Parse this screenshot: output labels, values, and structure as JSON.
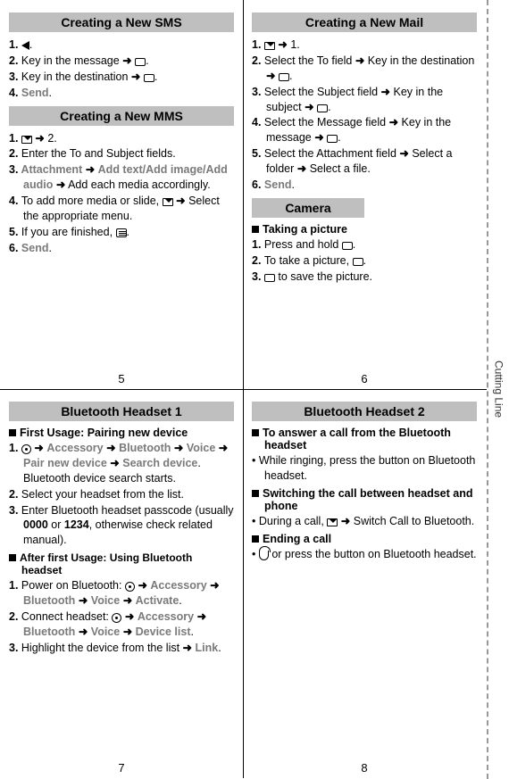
{
  "cutting_line": "Cutting Line",
  "pages": {
    "p5": "5",
    "p6": "6",
    "p7": "7",
    "p8": "8"
  },
  "q5": {
    "h1": "Creating a New SMS",
    "sms": [
      {
        "n": "1.",
        "parts": [
          {
            "icon": "tri"
          },
          {
            "t": "."
          }
        ]
      },
      {
        "n": "2.",
        "parts": [
          {
            "t": "Key in the message "
          },
          {
            "arrow": true
          },
          {
            "t": " "
          },
          {
            "icon": "mask"
          },
          {
            "t": "."
          }
        ]
      },
      {
        "n": "3.",
        "parts": [
          {
            "t": "Key in the destination "
          },
          {
            "arrow": true
          },
          {
            "t": " "
          },
          {
            "icon": "mask"
          },
          {
            "t": "."
          }
        ]
      },
      {
        "n": "4.",
        "parts": [
          {
            "bold": "Send"
          },
          {
            "t": "."
          }
        ]
      }
    ],
    "h2": "Creating a New MMS",
    "mms": [
      {
        "n": "1.",
        "parts": [
          {
            "icon": "msg"
          },
          {
            "t": " "
          },
          {
            "arrow": true
          },
          {
            "t": " 2."
          }
        ]
      },
      {
        "n": "2.",
        "parts": [
          {
            "t": "Enter the To and Subject fields."
          }
        ]
      },
      {
        "n": "3.",
        "parts": [
          {
            "bold": "Attachment"
          },
          {
            "t": " "
          },
          {
            "arrow": true
          },
          {
            "t": " "
          },
          {
            "bold": "Add text/Add image/Add audio"
          },
          {
            "t": " "
          },
          {
            "arrow": true
          },
          {
            "t": " Add each media accordingly."
          }
        ]
      },
      {
        "n": "4.",
        "parts": [
          {
            "t": "To add more media or slide, "
          },
          {
            "icon": "msg"
          },
          {
            "t": " "
          },
          {
            "arrow": true
          },
          {
            "t": " Select the appropriate menu."
          }
        ]
      },
      {
        "n": "5.",
        "parts": [
          {
            "t": "If you are finished, "
          },
          {
            "icon": "menu"
          },
          {
            "t": "."
          }
        ]
      },
      {
        "n": "6.",
        "parts": [
          {
            "bold": "Send"
          },
          {
            "t": "."
          }
        ]
      }
    ]
  },
  "q6": {
    "h1": "Creating a New Mail",
    "mail": [
      {
        "n": "1.",
        "parts": [
          {
            "icon": "msg"
          },
          {
            "t": " "
          },
          {
            "arrow": true
          },
          {
            "t": " 1."
          }
        ]
      },
      {
        "n": "2.",
        "parts": [
          {
            "t": "Select the To field "
          },
          {
            "arrow": true
          },
          {
            "t": " Key in the destination "
          },
          {
            "arrow": true
          },
          {
            "t": " "
          },
          {
            "icon": "mask"
          },
          {
            "t": "."
          }
        ]
      },
      {
        "n": "3.",
        "parts": [
          {
            "t": "Select the Subject field "
          },
          {
            "arrow": true
          },
          {
            "t": " Key in the subject "
          },
          {
            "arrow": true
          },
          {
            "t": " "
          },
          {
            "icon": "mask"
          },
          {
            "t": "."
          }
        ]
      },
      {
        "n": "4.",
        "parts": [
          {
            "t": "Select the Message field "
          },
          {
            "arrow": true
          },
          {
            "t": " Key in the message "
          },
          {
            "arrow": true
          },
          {
            "t": " "
          },
          {
            "icon": "mask"
          },
          {
            "t": "."
          }
        ]
      },
      {
        "n": "5.",
        "parts": [
          {
            "t": "Select the Attachment field "
          },
          {
            "arrow": true
          },
          {
            "t": " Select a folder "
          },
          {
            "arrow": true
          },
          {
            "t": " Select a file."
          }
        ]
      },
      {
        "n": "6.",
        "parts": [
          {
            "bold": "Send"
          },
          {
            "t": "."
          }
        ]
      }
    ],
    "h2": "Camera",
    "camera_sub": "Taking a picture",
    "camera": [
      {
        "n": "1.",
        "parts": [
          {
            "t": "Press and hold "
          },
          {
            "icon": "mask"
          },
          {
            "t": "."
          }
        ]
      },
      {
        "n": "2.",
        "parts": [
          {
            "t": "To take a picture, "
          },
          {
            "icon": "mask"
          },
          {
            "t": "."
          }
        ]
      },
      {
        "n": "3.",
        "parts": [
          {
            "icon": "mask"
          },
          {
            "t": " to save the picture."
          }
        ]
      }
    ]
  },
  "q7": {
    "h1": "Bluetooth Headset 1",
    "sub1": "First Usage: Pairing new device",
    "list1": [
      {
        "n": "1.",
        "parts": [
          {
            "icon": "round"
          },
          {
            "t": " "
          },
          {
            "arrow": true
          },
          {
            "t": " "
          },
          {
            "bold": "Accessory"
          },
          {
            "t": " "
          },
          {
            "arrow": true
          },
          {
            "t": " "
          },
          {
            "bold": "Bluetooth"
          },
          {
            "t": " "
          },
          {
            "arrow": true
          },
          {
            "t": " "
          },
          {
            "bold": "Voice"
          },
          {
            "t": " "
          },
          {
            "arrow": true
          },
          {
            "t": " "
          },
          {
            "bold": "Pair new device"
          },
          {
            "t": " "
          },
          {
            "arrow": true
          },
          {
            "t": " "
          },
          {
            "bold": "Search device"
          },
          {
            "t": ". Bluetooth device search starts."
          }
        ]
      },
      {
        "n": "2.",
        "parts": [
          {
            "t": "Select your headset from the list."
          }
        ]
      },
      {
        "n": "3.",
        "parts": [
          {
            "t": "Enter Bluetooth headset passcode (usually "
          },
          {
            "strong": "0000"
          },
          {
            "t": " or "
          },
          {
            "strong": "1234"
          },
          {
            "t": ", otherwise check related manual)."
          }
        ]
      }
    ],
    "sub2": "After first Usage: Using Bluetooth headset",
    "list2": [
      {
        "n": "1.",
        "parts": [
          {
            "t": "Power on Bluetooth: "
          },
          {
            "icon": "round"
          },
          {
            "t": " "
          },
          {
            "arrow": true
          },
          {
            "t": " "
          },
          {
            "bold": "Accessory"
          },
          {
            "t": " "
          },
          {
            "arrow": true
          },
          {
            "t": " "
          },
          {
            "bold": "Bluetooth"
          },
          {
            "t": " "
          },
          {
            "arrow": true
          },
          {
            "t": " "
          },
          {
            "bold": "Voice"
          },
          {
            "t": " "
          },
          {
            "arrow": true
          },
          {
            "t": " "
          },
          {
            "bold": "Activate"
          },
          {
            "t": "."
          }
        ]
      },
      {
        "n": "2.",
        "parts": [
          {
            "t": "Connect headset: "
          },
          {
            "icon": "round"
          },
          {
            "t": " "
          },
          {
            "arrow": true
          },
          {
            "t": " "
          },
          {
            "bold": "Accessory"
          },
          {
            "t": " "
          },
          {
            "arrow": true
          },
          {
            "t": " "
          },
          {
            "bold": "Bluetooth"
          },
          {
            "t": " "
          },
          {
            "arrow": true
          },
          {
            "t": " "
          },
          {
            "bold": "Voice"
          },
          {
            "t": " "
          },
          {
            "arrow": true
          },
          {
            "t": " "
          },
          {
            "bold": "Device list"
          },
          {
            "t": "."
          }
        ]
      },
      {
        "n": "3.",
        "parts": [
          {
            "t": "Highlight the device from the list "
          },
          {
            "arrow": true
          },
          {
            "t": " "
          },
          {
            "bold": "Link"
          },
          {
            "t": "."
          }
        ]
      }
    ]
  },
  "q8": {
    "h1": "Bluetooth Headset 2",
    "sub1": "To answer a call from the Bluetooth headset",
    "b1": [
      {
        "parts": [
          {
            "t": "While ringing, press the button on Bluetooth headset."
          }
        ]
      }
    ],
    "sub2": "Switching the call between headset and phone",
    "b2": [
      {
        "parts": [
          {
            "t": "During a call, "
          },
          {
            "icon": "msg"
          },
          {
            "t": " "
          },
          {
            "arrow": true
          },
          {
            "t": " Switch Call to Bluetooth."
          }
        ]
      }
    ],
    "sub3": "Ending a call",
    "b3": [
      {
        "parts": [
          {
            "icon": "headset"
          },
          {
            "t": " or press the button on Bluetooth headset."
          }
        ]
      }
    ]
  }
}
